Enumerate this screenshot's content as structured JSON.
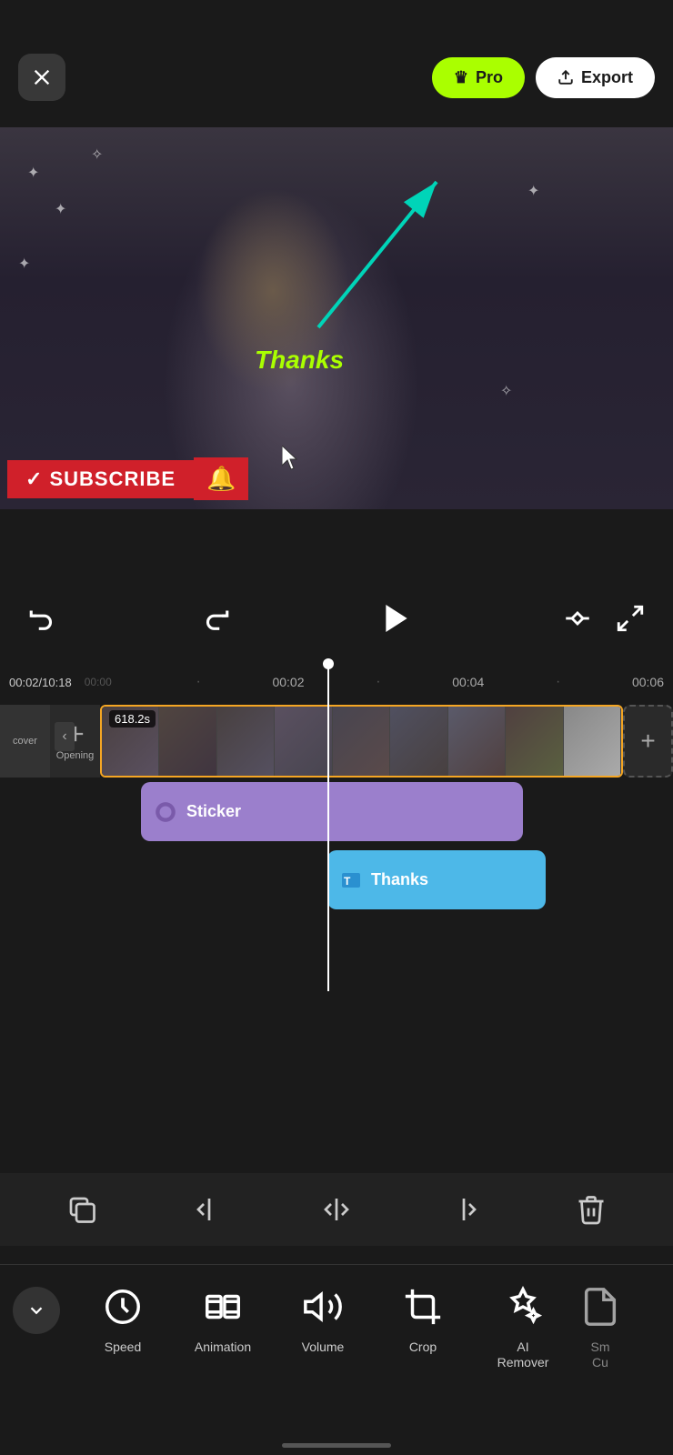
{
  "header": {
    "close_label": "×",
    "pro_label": "Pro",
    "export_label": "Export"
  },
  "video": {
    "thanks_text": "Thanks",
    "subscribe_text": "SUBSCRIBE"
  },
  "controls": {
    "time_current": "00:02",
    "time_total": "10:18",
    "time_start": "00:00"
  },
  "timeline": {
    "markers": [
      "00:00",
      "00:02",
      "00:04",
      "00:06"
    ],
    "track_duration": "618.2s",
    "track_labels": [
      "cover",
      "Opening"
    ]
  },
  "tracks": {
    "sticker_label": "Sticker",
    "thanks_label": "Thanks"
  },
  "toolbar_icons": [
    {
      "name": "copy",
      "symbol": "⧉"
    },
    {
      "name": "split-left",
      "symbol": "⊣"
    },
    {
      "name": "split",
      "symbol": "⊣⊢"
    },
    {
      "name": "split-right",
      "symbol": "⊢"
    },
    {
      "name": "delete",
      "symbol": "🗑"
    }
  ],
  "bottom_menu": {
    "collapse_icon": "∨",
    "items": [
      {
        "id": "speed",
        "label": "Speed",
        "icon": "speed"
      },
      {
        "id": "animation",
        "label": "Animation",
        "icon": "animation"
      },
      {
        "id": "volume",
        "label": "Volume",
        "icon": "volume"
      },
      {
        "id": "crop",
        "label": "Crop",
        "icon": "crop"
      },
      {
        "id": "ai-remover",
        "label": "AI\nRemover",
        "icon": "ai"
      },
      {
        "id": "sm-cu",
        "label": "Sm\nCu",
        "icon": "sm"
      }
    ]
  }
}
